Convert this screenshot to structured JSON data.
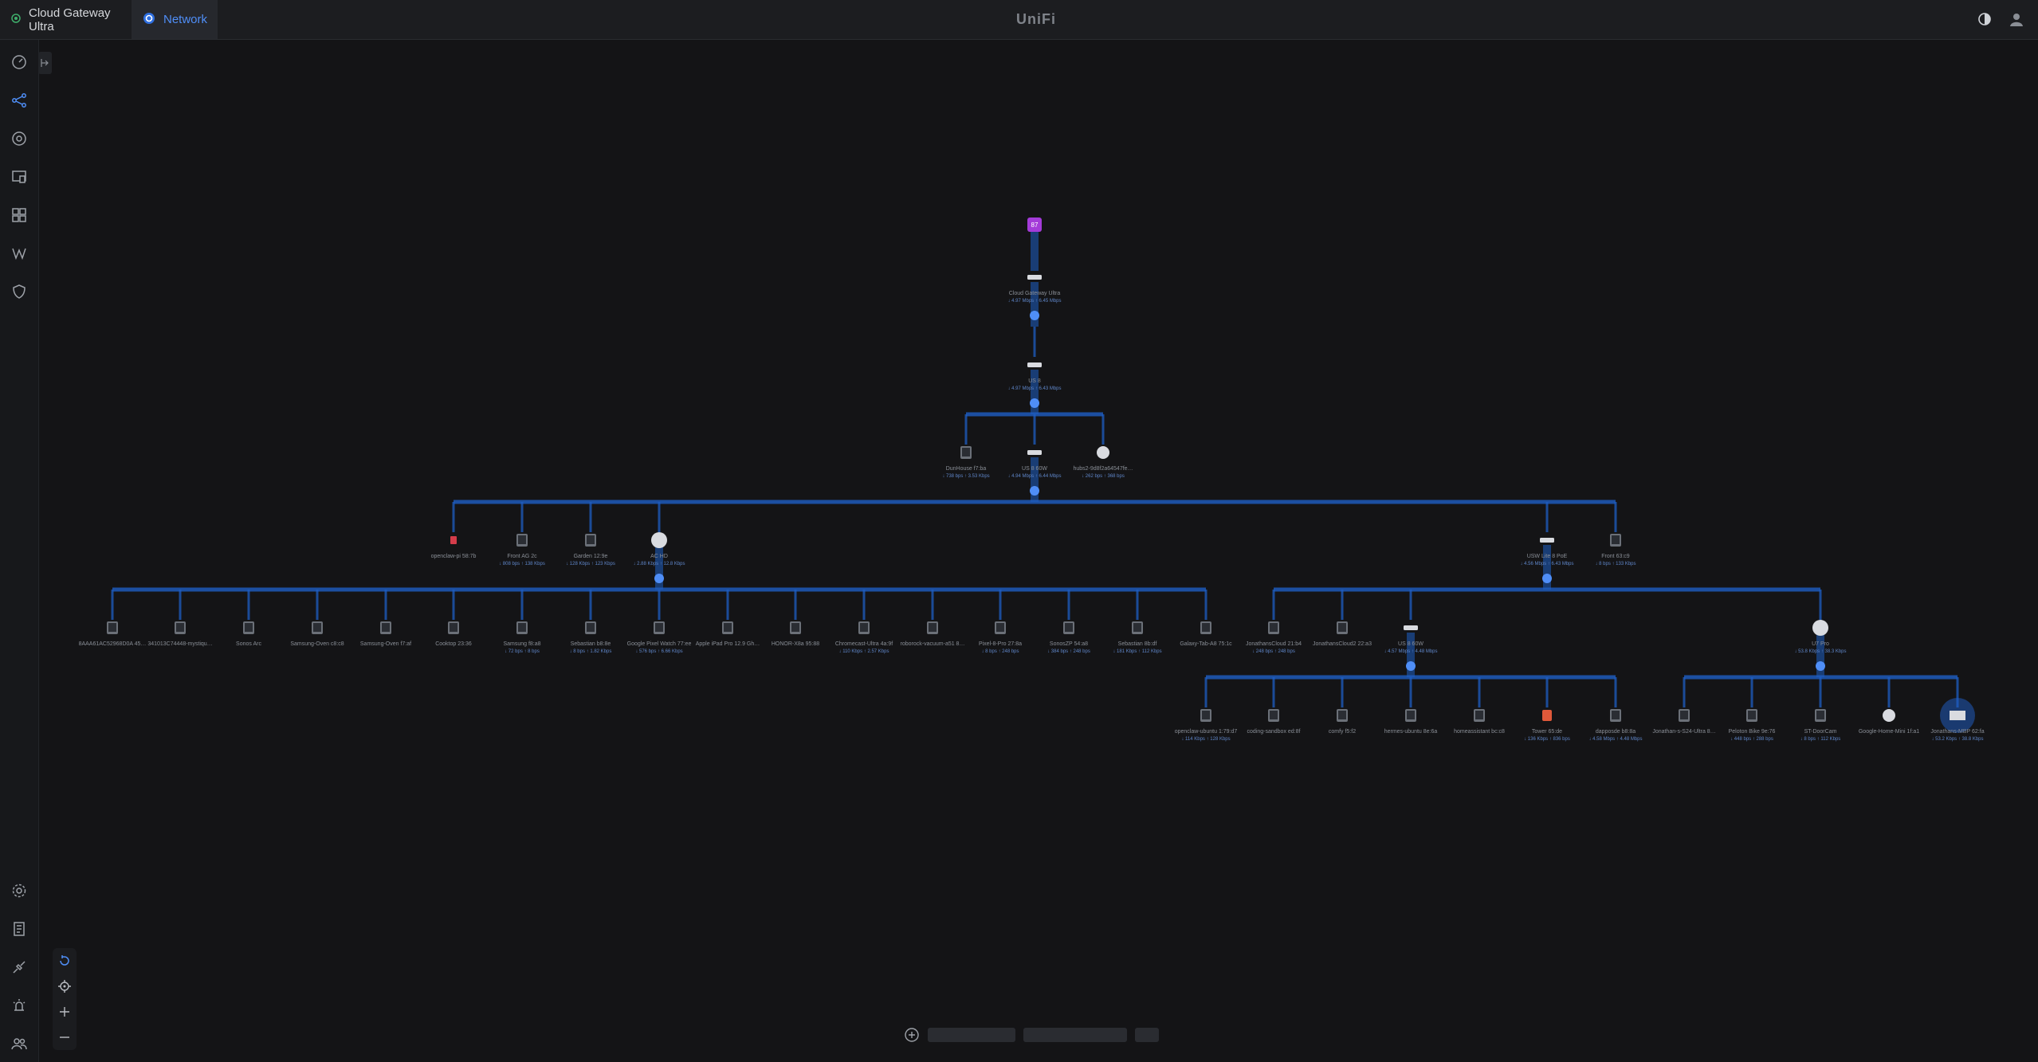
{
  "topbar": {
    "tab_gateway": "Cloud Gateway Ultra",
    "tab_network": "Network",
    "brand": "UniFi"
  },
  "colors": {
    "accent": "#4f8ef7",
    "link": "#1e5ec4",
    "node": "#d9dbe0",
    "gateway_badge": "#a43bd9"
  },
  "topology": {
    "gateway_badge_label": "87",
    "nodes": [
      {
        "id": "gw",
        "label": "Cloud Gateway Ultra",
        "down": "↓ 4.97 Mbps",
        "up": "↑ 6.45 Mbps"
      },
      {
        "id": "us8",
        "label": "US 8",
        "down": "↓ 4.97 Mbps",
        "up": "↑ 6.43 Mbps"
      },
      {
        "id": "dh",
        "label": "DunHouse f7:ba",
        "down": "↓ 738 bps",
        "up": "↑ 3.53 Kbps"
      },
      {
        "id": "us860w_a",
        "label": "US 8 60W",
        "down": "↓ 4.94 Mbps",
        "up": "↑ 6.44 Mbps"
      },
      {
        "id": "hubs",
        "label": "hubs2-9d8f2a64547fe…",
        "down": "↓ 262 bps",
        "up": "↑ 368 bps"
      },
      {
        "id": "oc",
        "label": "openclaw-pi 58:7b",
        "down": "",
        "up": ""
      },
      {
        "id": "front",
        "label": "Front AG 2c",
        "down": "↓ 808 bps",
        "up": "↑ 138 Kbps"
      },
      {
        "id": "garden",
        "label": "Garden 12:9e",
        "down": "↓ 128 Kbps",
        "up": "↑ 123 Kbps"
      },
      {
        "id": "achd",
        "label": "AC HD",
        "down": "↓ 2.88 Kbps",
        "up": "↑ 12.8 Kbps"
      },
      {
        "id": "usw",
        "label": "USW Lite 8 PoE",
        "down": "↓ 4.56 Mbps",
        "up": "↑ 6.43 Mbps"
      },
      {
        "id": "front63",
        "label": "Front 63:c9",
        "down": "↓ 8 bps",
        "up": "↑ 133 Kbps"
      },
      {
        "id": "c1",
        "label": "8AAA61AC52968D0A 45…",
        "down": "",
        "up": ""
      },
      {
        "id": "c2",
        "label": "341013C74448-mystiqu…",
        "down": "",
        "up": ""
      },
      {
        "id": "c3",
        "label": "Sonos Arc",
        "down": "",
        "up": ""
      },
      {
        "id": "c4",
        "label": "Samsung-Oven c8:c8",
        "down": "",
        "up": ""
      },
      {
        "id": "c5",
        "label": "Samsung-Oven f7:af",
        "down": "",
        "up": ""
      },
      {
        "id": "c6",
        "label": "Cooktop 23:36",
        "down": "",
        "up": ""
      },
      {
        "id": "c7",
        "label": "Samsung f8:a8",
        "down": "↓ 72 bps",
        "up": "↑ 8 bps"
      },
      {
        "id": "c8",
        "label": "Sebastian b8:8e",
        "down": "↓ 8 bps",
        "up": "↑ 1.82 Kbps"
      },
      {
        "id": "c9",
        "label": "Google Pixel Watch 77:ee",
        "down": "↓ 576 bps",
        "up": "↑ 6.66 Kbps"
      },
      {
        "id": "c10",
        "label": "Apple iPad Pro 12.9 Gh…",
        "down": "",
        "up": ""
      },
      {
        "id": "c11",
        "label": "HONOR-X8a 95:88",
        "down": "",
        "up": ""
      },
      {
        "id": "c12",
        "label": "Chromecast-Ultra 4a:9f",
        "down": "↓ 110 Kbps",
        "up": "↑ 2.57 Kbps"
      },
      {
        "id": "c13",
        "label": "roborock-vacuum-a51 8…",
        "down": "",
        "up": ""
      },
      {
        "id": "c14",
        "label": "Pixel-8-Pro 27:8a",
        "down": "↓ 8 bps",
        "up": "↑ 248 bps"
      },
      {
        "id": "c15",
        "label": "SonosZP 54:a8",
        "down": "↓ 384 bps",
        "up": "↑ 248 bps"
      },
      {
        "id": "c16",
        "label": "Sebastian 8b:df",
        "down": "↓ 181 Kbps",
        "up": "↑ 112 Kbps"
      },
      {
        "id": "c17",
        "label": "Galaxy-Tab-A8 75:1c",
        "down": "",
        "up": ""
      },
      {
        "id": "c18",
        "label": "JonathansCloud 21:b4",
        "down": "↓ 248 bps",
        "up": "↑ 248 bps"
      },
      {
        "id": "c19",
        "label": "JonathansCloud2 22:a3",
        "down": "",
        "up": ""
      },
      {
        "id": "c20",
        "label": "US 8 60W",
        "down": "↓ 4.57 Mbps",
        "up": "↑ 4.48 Mbps"
      },
      {
        "id": "u7",
        "label": "U7 Pro",
        "down": "↓ 53.8 Kbps",
        "up": "↑ 38.3 Kbps"
      },
      {
        "id": "d1",
        "label": "openclaw-ubuntu 1:79:d7",
        "down": "↓ 114 Kbps",
        "up": "↑ 128 Kbps"
      },
      {
        "id": "d2",
        "label": "coding-sandbox ed:8f",
        "down": "",
        "up": ""
      },
      {
        "id": "d3",
        "label": "comfy f5:f2",
        "down": "",
        "up": ""
      },
      {
        "id": "d4",
        "label": "hermes-ubuntu 8e:6a",
        "down": "",
        "up": ""
      },
      {
        "id": "d5",
        "label": "homeassistant bc:c8",
        "down": "",
        "up": ""
      },
      {
        "id": "d6",
        "label": "Tower 65:de",
        "down": "↓ 136 Kbps",
        "up": "↑ 836 bps"
      },
      {
        "id": "d7",
        "label": "dapposde b8:8a",
        "down": "↓ 4.58 Mbps",
        "up": "↑ 4.48 Mbps"
      },
      {
        "id": "d8",
        "label": "Jonathan-s-S24-Ultra 8…",
        "down": "",
        "up": ""
      },
      {
        "id": "d9",
        "label": "Peloton Bike 9e:76",
        "down": "↓ 448 bps",
        "up": "↑ 288 bps"
      },
      {
        "id": "d10",
        "label": "ST-DoorCam",
        "down": "↓ 8 bps",
        "up": "↑ 112 Kbps"
      },
      {
        "id": "d11",
        "label": "Google-Home-Mini 1f:a1",
        "down": "",
        "up": ""
      },
      {
        "id": "d12",
        "label": "Jonathans-MBP 62:fa",
        "down": "↓ 53.2 Kbps",
        "up": "↑ 38.8 Kbps"
      }
    ]
  }
}
